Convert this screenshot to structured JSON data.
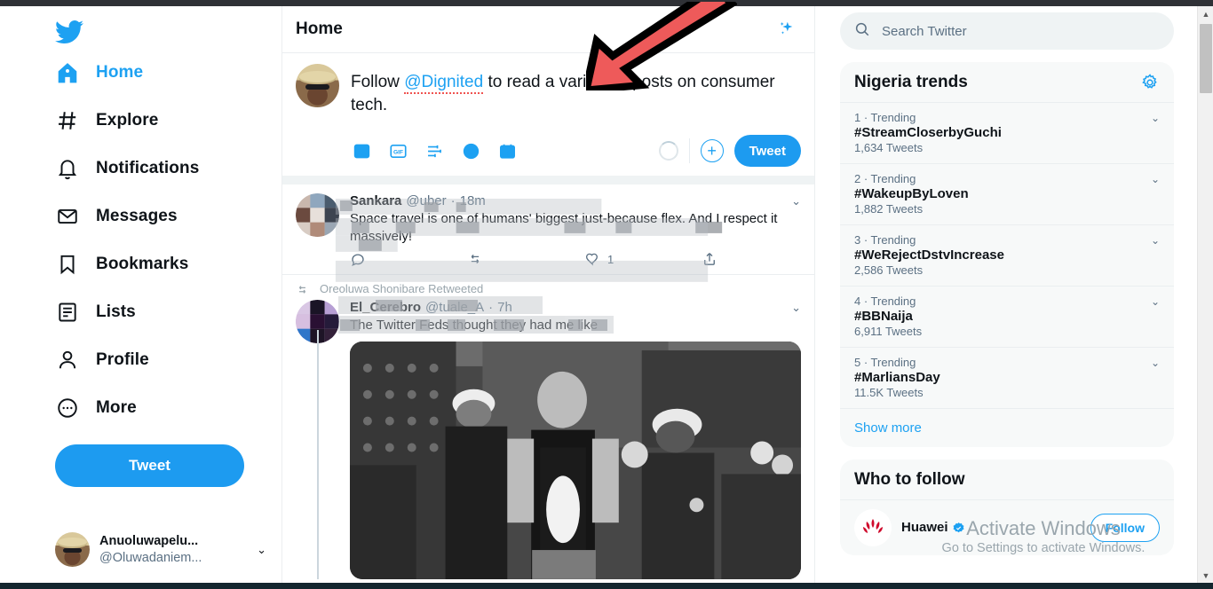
{
  "app": {
    "name": "Twitter"
  },
  "sidebar": {
    "logo_icon": "twitter-bird-icon",
    "items": [
      {
        "label": "Home",
        "icon": "home-icon",
        "active": true
      },
      {
        "label": "Explore",
        "icon": "hashtag-icon",
        "active": false
      },
      {
        "label": "Notifications",
        "icon": "bell-icon",
        "active": false
      },
      {
        "label": "Messages",
        "icon": "envelope-icon",
        "active": false
      },
      {
        "label": "Bookmarks",
        "icon": "bookmark-icon",
        "active": false
      },
      {
        "label": "Lists",
        "icon": "list-icon",
        "active": false
      },
      {
        "label": "Profile",
        "icon": "person-icon",
        "active": false
      },
      {
        "label": "More",
        "icon": "ellipsis-circle-icon",
        "active": false
      }
    ],
    "tweet_button": "Tweet",
    "account": {
      "name": "Anuoluwapelu...",
      "handle": "@Oluwadaniem...",
      "chevron": "⌄"
    }
  },
  "main": {
    "header": {
      "title": "Home",
      "sparkle_icon": "sparkles-icon"
    },
    "compose": {
      "text_prefix": "Follow ",
      "mention": "@Dignited",
      "text_suffix": " to read a variety of posts on consumer tech.",
      "actions": [
        {
          "icon": "image-icon",
          "label": "Media"
        },
        {
          "icon": "gif-icon",
          "label": "GIF"
        },
        {
          "icon": "poll-icon",
          "label": "Poll"
        },
        {
          "icon": "emoji-icon",
          "label": "Emoji"
        },
        {
          "icon": "schedule-icon",
          "label": "Schedule"
        }
      ],
      "char_ring_icon": "character-count-ring",
      "add_icon": "plus-circle-icon",
      "tweet_button": "Tweet"
    },
    "tweets": [
      {
        "name": "Sankara",
        "handle": "@uber",
        "dot": "·",
        "time": "18m",
        "text": "Space travel is one of humans' biggest just-because flex. And I respect it massively!",
        "caret": "⌄",
        "actions": {
          "reply_icon": "reply-icon",
          "reply_count": "",
          "retweet_icon": "retweet-icon",
          "retweet_count": "",
          "like_icon": "heart-icon",
          "like_count": "1",
          "share_icon": "share-icon"
        }
      },
      {
        "retweeted_by": "Oreoluwa Shonibare Retweeted",
        "retweet_icon": "retweet-icon",
        "name": "El_Cerebro",
        "handle": "@tuale_A",
        "dot": "·",
        "time": "7h",
        "text": "The Twitter Feds thought they had me like",
        "caret": "⌄",
        "media_alt": "video-thumbnail"
      }
    ]
  },
  "right": {
    "search": {
      "placeholder": "Search Twitter",
      "value": "",
      "icon": "search-icon"
    },
    "trends": {
      "title": "Nigeria trends",
      "settings_icon": "gear-icon",
      "items": [
        {
          "rank": "1 · Trending",
          "name": "#StreamCloserbyGuchi",
          "count": "1,634 Tweets",
          "caret": "⌄"
        },
        {
          "rank": "2 · Trending",
          "name": "#WakeupByLoven",
          "count": "1,882 Tweets",
          "caret": "⌄"
        },
        {
          "rank": "3 · Trending",
          "name": "#WeRejectDstvIncrease",
          "count": "2,586 Tweets",
          "caret": "⌄"
        },
        {
          "rank": "4 · Trending",
          "name": "#BBNaija",
          "count": "6,911 Tweets",
          "caret": "⌄"
        },
        {
          "rank": "5 · Trending",
          "name": "#MarliansDay",
          "count": "11.5K Tweets",
          "caret": "⌄"
        }
      ],
      "show_more": "Show more"
    },
    "who_to_follow": {
      "title": "Who to follow",
      "items": [
        {
          "name": "Huawei",
          "verified_icon": "verified-badge-icon",
          "follow_label": "Follow"
        }
      ]
    }
  },
  "watermark": {
    "line1": "Activate Windows",
    "line2": "Go to Settings to activate Windows."
  },
  "annotation": {
    "arrow_icon": "red-arrow-annotation",
    "color": "#ee5a5a"
  },
  "scrollbar": {
    "up_icon": "▲",
    "down_icon": "▼"
  },
  "colors": {
    "accent": "#1da1f2",
    "tweet_button": "#1d9bf0",
    "muted": "#5b7083",
    "panel": "#f7f9f9"
  }
}
